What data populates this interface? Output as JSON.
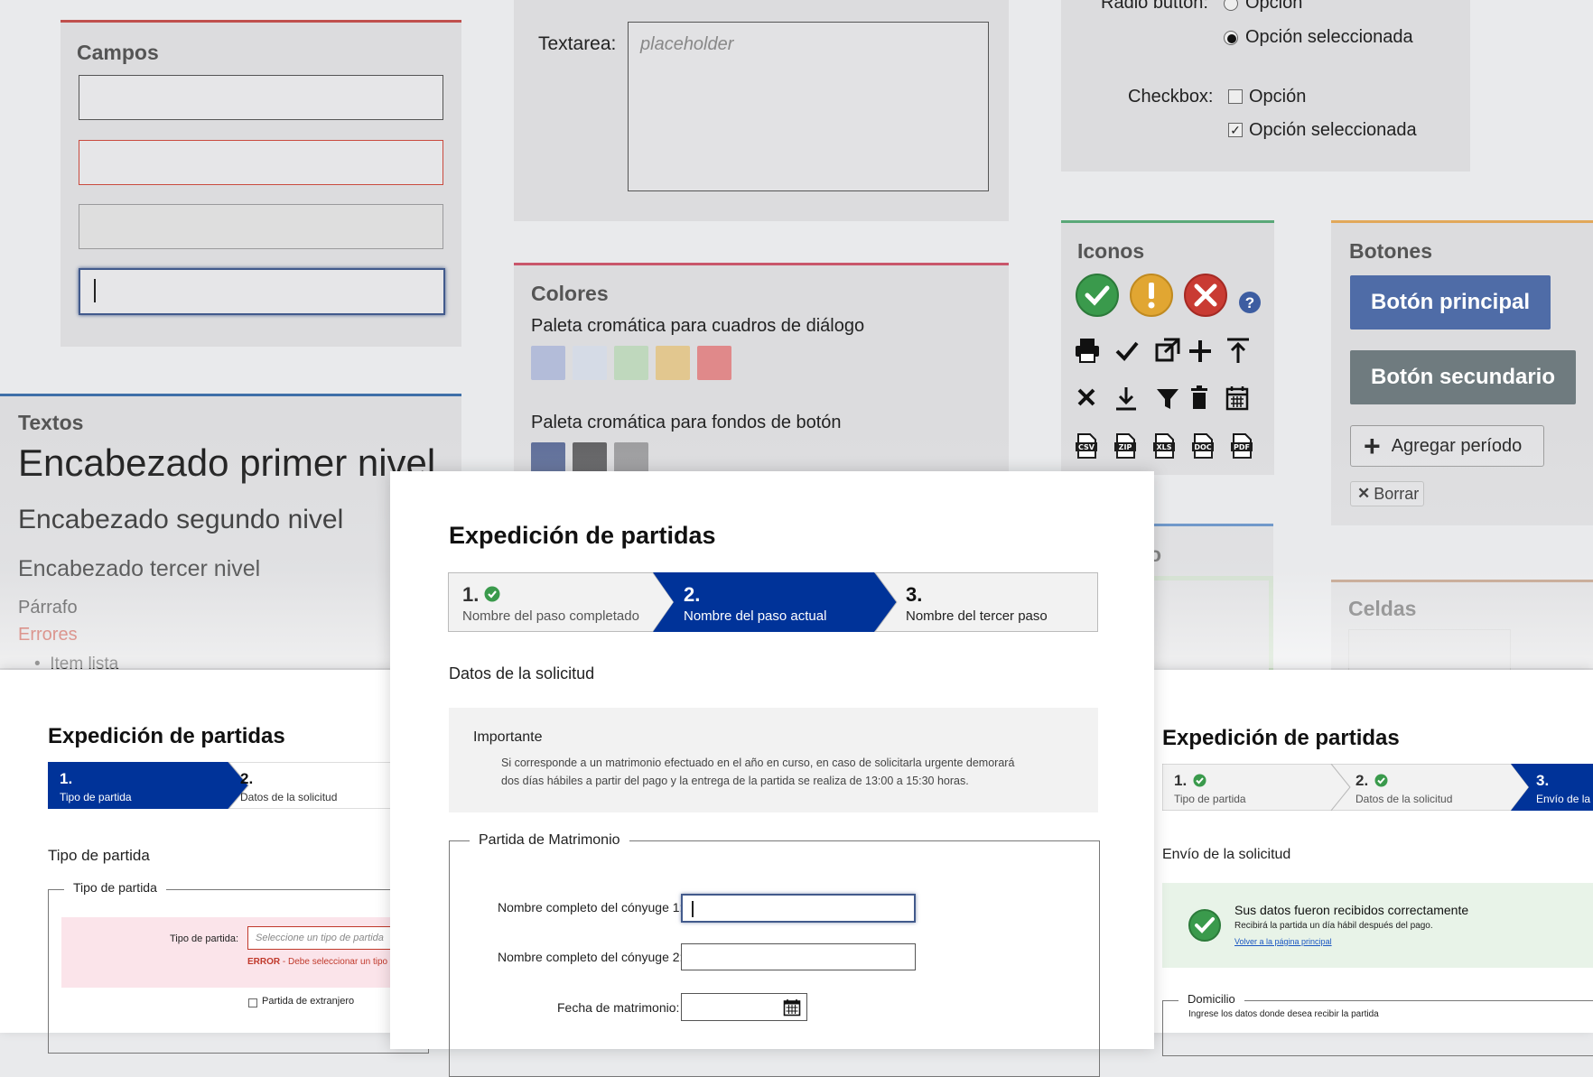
{
  "campos": {
    "title": "Campos"
  },
  "textarea": {
    "label": "Textarea:",
    "placeholder": "placeholder"
  },
  "radio": {
    "label": "Radio button:",
    "option": "Opción",
    "selected": "Opción seleccionada"
  },
  "checkbox": {
    "label": "Checkbox:",
    "option": "Opción",
    "selected": "Opción seleccionada"
  },
  "colores": {
    "title": "Colores",
    "palette1_label": "Paleta cromática para cuadros de diálogo",
    "palette1": [
      "#b3bcd9",
      "#d5dbe6",
      "#bfd8bd",
      "#e2c78f",
      "#e0898a"
    ],
    "palette2_label": "Paleta cromática para fondos de botón",
    "palette2": [
      "#5a6a96",
      "#5d5d5f",
      "#9a9a9c"
    ]
  },
  "iconos": {
    "title": "Iconos",
    "status_icons": [
      "check-circle-icon",
      "warning-circle-icon",
      "error-circle-icon",
      "help-icon"
    ],
    "row1": [
      "print-icon",
      "check-icon",
      "open-window-icon",
      "plus-icon",
      "upload-icon"
    ],
    "row2": [
      "close-icon",
      "download-icon",
      "filter-icon",
      "trash-icon",
      "calendar-icon"
    ],
    "file_labels": [
      "CSV",
      "ZIP",
      "XLS",
      "DOC",
      "PDF"
    ]
  },
  "botones": {
    "title": "Botones",
    "primary": "Botón principal",
    "secondary": "Botón secundario",
    "add": "Agregar período",
    "delete": "Borrar"
  },
  "textos": {
    "title": "Textos",
    "h1": "Encabezado primer nivel",
    "h2": "Encabezado segundo nivel",
    "h3": "Encabezado tercer nivel",
    "p": "Párrafo",
    "error": "Errores",
    "list_item": "Item lista"
  },
  "celdas": {
    "title": "Celdas"
  },
  "hidden_panel_fragment": "o",
  "colors": {
    "primary_blue": "#003399",
    "button_blue": "#4f6ca7",
    "button_gray": "#6f7b7f",
    "green": "#3a9a4c",
    "yellow": "#e1a632",
    "red": "#c93b33"
  },
  "center_sheet": {
    "title": "Expedición de partidas",
    "steps": [
      {
        "num": "1.",
        "name": "Nombre del paso completado",
        "state": "completed"
      },
      {
        "num": "2.",
        "name": "Nombre del paso actual",
        "state": "current"
      },
      {
        "num": "3.",
        "name": "Nombre del tercer paso",
        "state": "pending"
      }
    ],
    "section": "Datos de la solicitud",
    "notice_title": "Importante",
    "notice_line1": "Si corresponde a un matrimonio efectuado en el año en curso, en caso de solicitarla urgente demorará",
    "notice_line2": "dos días hábiles a partir del pago y la entrega de la partida se realiza de 13:00 a 15:30 horas.",
    "fieldset": "Partida de Matrimonio",
    "field1": "Nombre completo del cónyuge 1:",
    "field2": "Nombre completo del cónyuge 2:",
    "field3": "Fecha de matrimonio:"
  },
  "left_sheet": {
    "title": "Expedición de partidas",
    "steps": [
      {
        "num": "1.",
        "name": "Tipo de partida",
        "state": "current"
      },
      {
        "num": "2.",
        "name": "Datos de la solicitud",
        "state": "pending"
      }
    ],
    "section": "Tipo de partida",
    "fieldset": "Tipo de partida",
    "field_label": "Tipo de partida:",
    "field_placeholder": "Seleccione un tipo de partida",
    "error_strong": "ERROR",
    "error_text": " - Debe seleccionar un tipo d",
    "checkbox_label": "Partida de extranjero"
  },
  "right_sheet": {
    "title": "Expedición de partidas",
    "steps": [
      {
        "num": "1.",
        "name": "Tipo de partida",
        "state": "completed"
      },
      {
        "num": "2.",
        "name": "Datos de la solicitud",
        "state": "completed"
      },
      {
        "num": "3.",
        "name": "Envío de la",
        "state": "current"
      }
    ],
    "section": "Envío de la solicitud",
    "success_title": "Sus datos fueron recibidos correctamente",
    "success_text": "Recibirá la partida un día hábil después del pago.",
    "success_link": "Volver a la página principal",
    "fieldset": "Domicilio",
    "fieldset_hint": "Ingrese los datos donde desea recibir la partida"
  }
}
